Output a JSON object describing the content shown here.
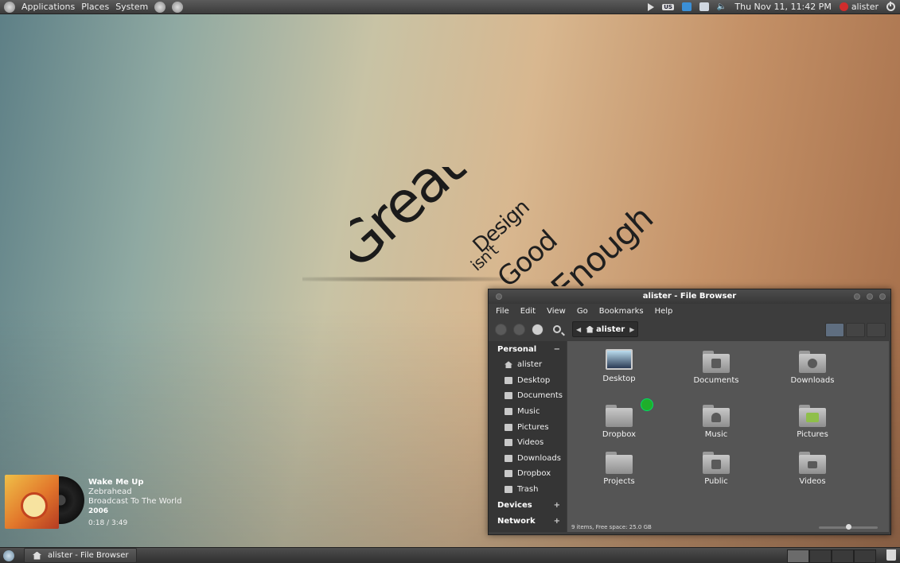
{
  "top_panel": {
    "menus": [
      "Applications",
      "Places",
      "System"
    ],
    "keyboard_layout": "US",
    "clock": "Thu Nov 11, 11:42 PM",
    "user": "alister"
  },
  "wallpaper": {
    "words": [
      "Great",
      "Design",
      "isn't",
      "Good",
      "Enough"
    ]
  },
  "music": {
    "title": "Wake Me Up",
    "artist": "Zebrahead",
    "album": "Broadcast To The World",
    "year": "2006",
    "time": "0:18 / 3:49"
  },
  "file_browser": {
    "title": "alister - File Browser",
    "menu": [
      "File",
      "Edit",
      "View",
      "Go",
      "Bookmarks",
      "Help"
    ],
    "location": "alister",
    "sidebar": {
      "personal_label": "Personal",
      "personal_sign": "−",
      "items": [
        "alister",
        "Desktop",
        "Documents",
        "Music",
        "Pictures",
        "Videos",
        "Downloads",
        "Dropbox",
        "Trash"
      ],
      "devices_label": "Devices",
      "devices_sign": "+",
      "network_label": "Network",
      "network_sign": "+"
    },
    "items": [
      "Desktop",
      "Documents",
      "Downloads",
      "Dropbox",
      "Music",
      "Pictures",
      "Projects",
      "Public",
      "Videos"
    ],
    "status": "9 items, Free space: 25.0 GB",
    "zoom_level": 0.5
  },
  "taskbar": {
    "window_button": "alister - File Browser"
  }
}
